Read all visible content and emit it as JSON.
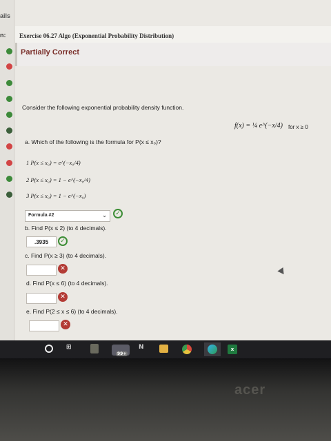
{
  "breadcrumb": {
    "top": "ails",
    "left_label": "n:"
  },
  "header": {
    "title": "Exercise 06.27 Algo (Exponential Probability Distribution)",
    "status": "Partially Correct"
  },
  "question": {
    "intro": "Consider the following exponential probability density function.",
    "pdf": "f(x) = ¼ e^(−x/4)",
    "pdf_cond": "for x ≥ 0"
  },
  "part_a": {
    "prompt": "a. Which of the following is the formula for P(x ≤ x₀)?",
    "options": [
      "1  P(x ≤ x₀) = e^(−x₀/4)",
      "2  P(x ≤ x₀) = 1 − e^(−x₀/4)",
      "3  P(x ≤ x₀) = 1 − e^(−x₀)"
    ],
    "selected": "Formula #2",
    "caret": "⌄"
  },
  "part_b": {
    "prompt": "b. Find P(x ≤ 2) (to 4 decimals).",
    "answer": ".3935"
  },
  "part_c": {
    "prompt": "c. Find P(x ≥ 3) (to 4 decimals).",
    "answer": ""
  },
  "part_d": {
    "prompt": "d. Find P(x ≤ 6) (to 4 decimals).",
    "answer": ""
  },
  "part_e": {
    "prompt": "e. Find P(2 ≤ x ≤ 6) (to 4 decimals).",
    "answer": ""
  },
  "marks": {
    "correct": "✓",
    "wrong": "✕"
  },
  "taskbar": {
    "badge": "99+",
    "icons": [
      "windows-icon",
      "task-view-icon",
      "calculator-icon",
      "badge-app-icon",
      "notes-icon",
      "files-icon",
      "chrome-icon",
      "edge-icon",
      "excel-icon"
    ]
  },
  "colors": {
    "correct": "#3c8d35",
    "incorrect": "#b33b35",
    "status": "#7a2f2a"
  },
  "bezel": {
    "brand": "acer"
  }
}
